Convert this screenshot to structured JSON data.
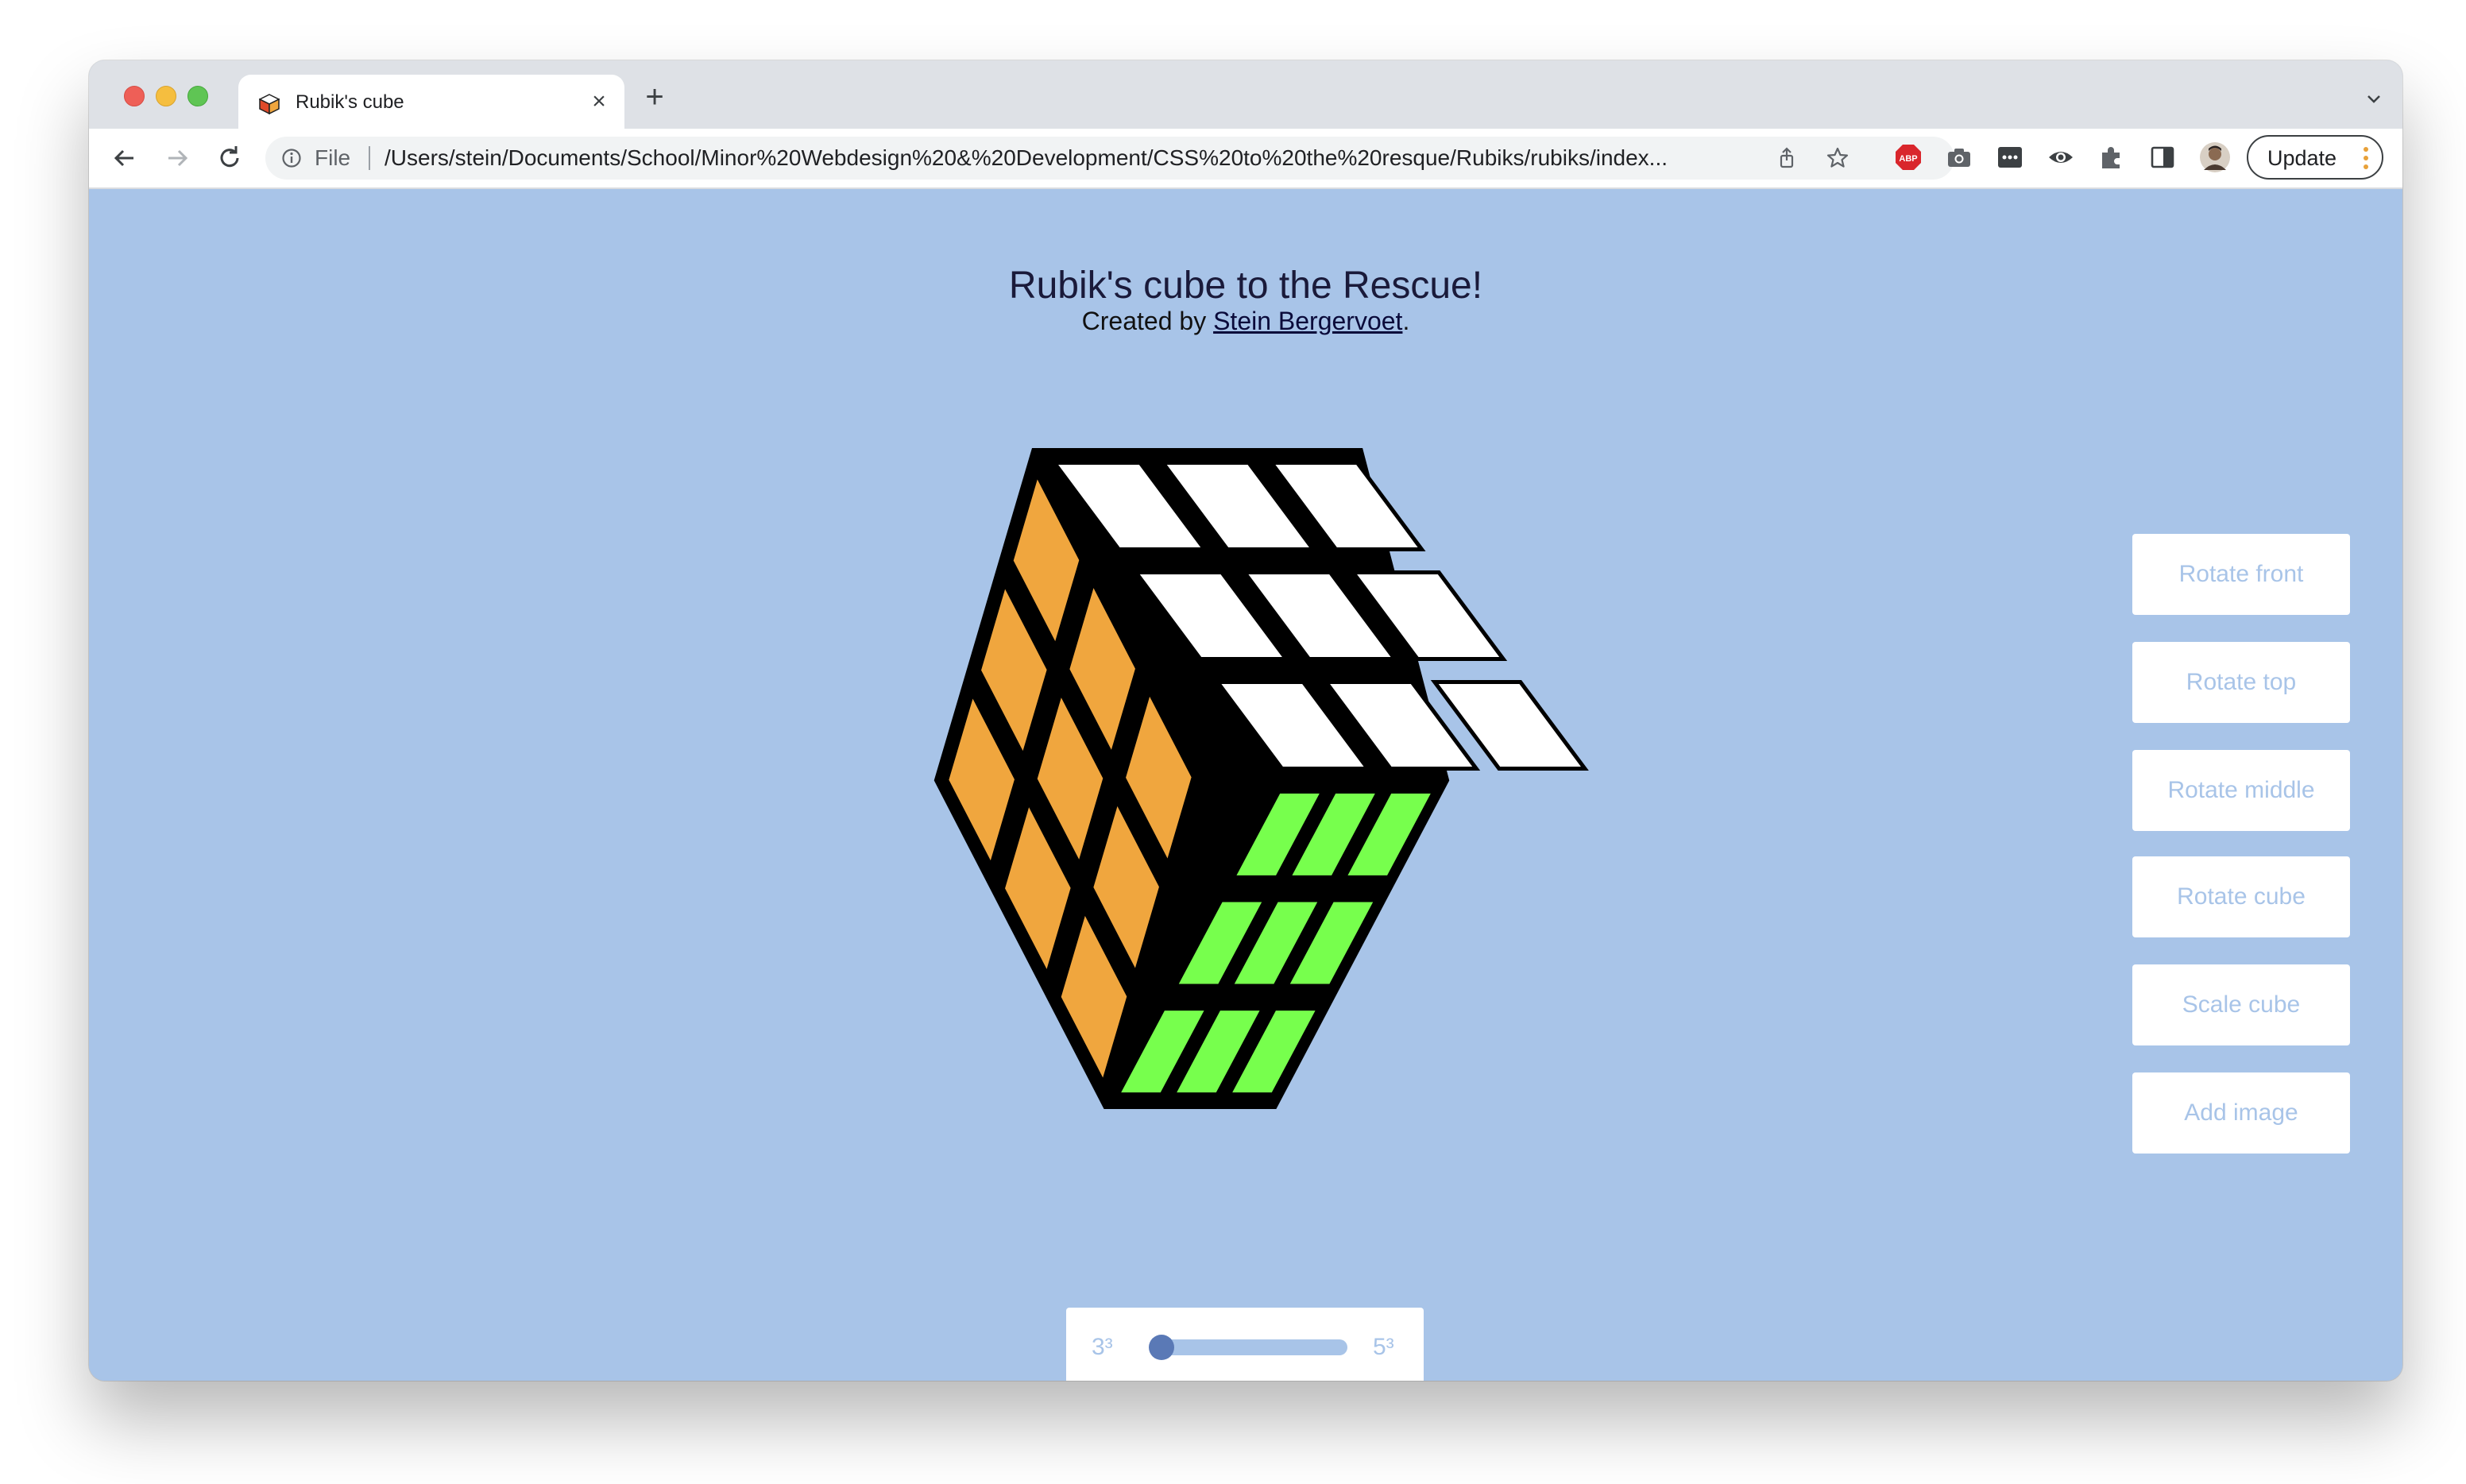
{
  "browser": {
    "tab_title": "Rubik's cube",
    "scheme_label": "File",
    "url": "/Users/stein/Documents/School/Minor%20Webdesign%20&%20Development/CSS%20to%20the%20resque/Rubiks/rubiks/index...",
    "update_label": "Update",
    "new_tab_symbol": "+",
    "close_symbol": "×"
  },
  "page": {
    "title": "Rubik's cube to the Rescue!",
    "subtitle_prefix": "Created by ",
    "author_link": "Stein Bergervoet",
    "subtitle_suffix": ".",
    "background_color": "#a8c4e8"
  },
  "controls": {
    "buttons": [
      {
        "label": "Rotate front"
      },
      {
        "label": "Rotate top"
      },
      {
        "label": "Rotate middle"
      },
      {
        "label": "Rotate cube"
      },
      {
        "label": "Scale cube"
      },
      {
        "label": "Add image"
      }
    ],
    "size_slider": {
      "min_label": "3³",
      "max_label": "5³",
      "value": 0
    }
  },
  "cube": {
    "colors": {
      "top": "#ffffff",
      "left": "#f0a63e",
      "right": "#77ff4d",
      "edge": "#000000"
    }
  }
}
